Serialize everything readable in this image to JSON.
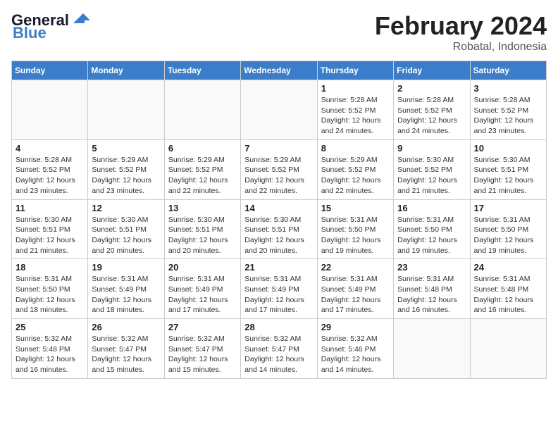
{
  "header": {
    "logo_general": "General",
    "logo_blue": "Blue",
    "month_title": "February 2024",
    "location": "Robatal, Indonesia"
  },
  "weekdays": [
    "Sunday",
    "Monday",
    "Tuesday",
    "Wednesday",
    "Thursday",
    "Friday",
    "Saturday"
  ],
  "weeks": [
    [
      {
        "day": "",
        "info": ""
      },
      {
        "day": "",
        "info": ""
      },
      {
        "day": "",
        "info": ""
      },
      {
        "day": "",
        "info": ""
      },
      {
        "day": "1",
        "info": "Sunrise: 5:28 AM\nSunset: 5:52 PM\nDaylight: 12 hours\nand 24 minutes."
      },
      {
        "day": "2",
        "info": "Sunrise: 5:28 AM\nSunset: 5:52 PM\nDaylight: 12 hours\nand 24 minutes."
      },
      {
        "day": "3",
        "info": "Sunrise: 5:28 AM\nSunset: 5:52 PM\nDaylight: 12 hours\nand 23 minutes."
      }
    ],
    [
      {
        "day": "4",
        "info": "Sunrise: 5:28 AM\nSunset: 5:52 PM\nDaylight: 12 hours\nand 23 minutes."
      },
      {
        "day": "5",
        "info": "Sunrise: 5:29 AM\nSunset: 5:52 PM\nDaylight: 12 hours\nand 23 minutes."
      },
      {
        "day": "6",
        "info": "Sunrise: 5:29 AM\nSunset: 5:52 PM\nDaylight: 12 hours\nand 22 minutes."
      },
      {
        "day": "7",
        "info": "Sunrise: 5:29 AM\nSunset: 5:52 PM\nDaylight: 12 hours\nand 22 minutes."
      },
      {
        "day": "8",
        "info": "Sunrise: 5:29 AM\nSunset: 5:52 PM\nDaylight: 12 hours\nand 22 minutes."
      },
      {
        "day": "9",
        "info": "Sunrise: 5:30 AM\nSunset: 5:52 PM\nDaylight: 12 hours\nand 21 minutes."
      },
      {
        "day": "10",
        "info": "Sunrise: 5:30 AM\nSunset: 5:51 PM\nDaylight: 12 hours\nand 21 minutes."
      }
    ],
    [
      {
        "day": "11",
        "info": "Sunrise: 5:30 AM\nSunset: 5:51 PM\nDaylight: 12 hours\nand 21 minutes."
      },
      {
        "day": "12",
        "info": "Sunrise: 5:30 AM\nSunset: 5:51 PM\nDaylight: 12 hours\nand 20 minutes."
      },
      {
        "day": "13",
        "info": "Sunrise: 5:30 AM\nSunset: 5:51 PM\nDaylight: 12 hours\nand 20 minutes."
      },
      {
        "day": "14",
        "info": "Sunrise: 5:30 AM\nSunset: 5:51 PM\nDaylight: 12 hours\nand 20 minutes."
      },
      {
        "day": "15",
        "info": "Sunrise: 5:31 AM\nSunset: 5:50 PM\nDaylight: 12 hours\nand 19 minutes."
      },
      {
        "day": "16",
        "info": "Sunrise: 5:31 AM\nSunset: 5:50 PM\nDaylight: 12 hours\nand 19 minutes."
      },
      {
        "day": "17",
        "info": "Sunrise: 5:31 AM\nSunset: 5:50 PM\nDaylight: 12 hours\nand 19 minutes."
      }
    ],
    [
      {
        "day": "18",
        "info": "Sunrise: 5:31 AM\nSunset: 5:50 PM\nDaylight: 12 hours\nand 18 minutes."
      },
      {
        "day": "19",
        "info": "Sunrise: 5:31 AM\nSunset: 5:49 PM\nDaylight: 12 hours\nand 18 minutes."
      },
      {
        "day": "20",
        "info": "Sunrise: 5:31 AM\nSunset: 5:49 PM\nDaylight: 12 hours\nand 17 minutes."
      },
      {
        "day": "21",
        "info": "Sunrise: 5:31 AM\nSunset: 5:49 PM\nDaylight: 12 hours\nand 17 minutes."
      },
      {
        "day": "22",
        "info": "Sunrise: 5:31 AM\nSunset: 5:49 PM\nDaylight: 12 hours\nand 17 minutes."
      },
      {
        "day": "23",
        "info": "Sunrise: 5:31 AM\nSunset: 5:48 PM\nDaylight: 12 hours\nand 16 minutes."
      },
      {
        "day": "24",
        "info": "Sunrise: 5:31 AM\nSunset: 5:48 PM\nDaylight: 12 hours\nand 16 minutes."
      }
    ],
    [
      {
        "day": "25",
        "info": "Sunrise: 5:32 AM\nSunset: 5:48 PM\nDaylight: 12 hours\nand 16 minutes."
      },
      {
        "day": "26",
        "info": "Sunrise: 5:32 AM\nSunset: 5:47 PM\nDaylight: 12 hours\nand 15 minutes."
      },
      {
        "day": "27",
        "info": "Sunrise: 5:32 AM\nSunset: 5:47 PM\nDaylight: 12 hours\nand 15 minutes."
      },
      {
        "day": "28",
        "info": "Sunrise: 5:32 AM\nSunset: 5:47 PM\nDaylight: 12 hours\nand 14 minutes."
      },
      {
        "day": "29",
        "info": "Sunrise: 5:32 AM\nSunset: 5:46 PM\nDaylight: 12 hours\nand 14 minutes."
      },
      {
        "day": "",
        "info": ""
      },
      {
        "day": "",
        "info": ""
      }
    ]
  ]
}
